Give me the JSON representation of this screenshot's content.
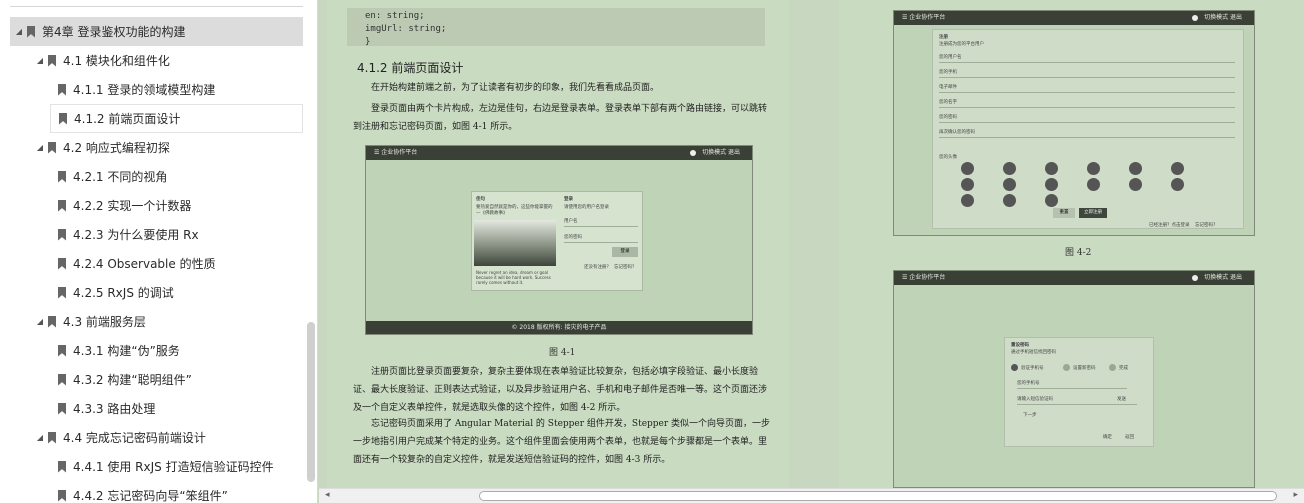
{
  "toc": [
    {
      "label": "第4章 登录鉴权功能的构建",
      "level": 0,
      "state": "selected"
    },
    {
      "label": "4.1 模块化和组件化",
      "level": 1
    },
    {
      "label": "4.1.1 登录的领域模型构建",
      "level": 2
    },
    {
      "label": "4.1.2 前端页面设计",
      "level": 2,
      "state": "current"
    },
    {
      "label": "4.2 响应式编程初探",
      "level": 1
    },
    {
      "label": "4.2.1 不同的视角",
      "level": 2
    },
    {
      "label": "4.2.2 实现一个计数器",
      "level": 2
    },
    {
      "label": "4.2.3 为什么要使用 Rx",
      "level": 2
    },
    {
      "label": "4.2.4 Observable 的性质",
      "level": 2
    },
    {
      "label": "4.2.5 RxJS 的调试",
      "level": 2
    },
    {
      "label": "4.3 前端服务层",
      "level": 1
    },
    {
      "label": "4.3.1 构建“伪”服务",
      "level": 2
    },
    {
      "label": "4.3.2 构建“聪明组件”",
      "level": 2
    },
    {
      "label": "4.3.3 路由处理",
      "level": 2
    },
    {
      "label": "4.4 完成忘记密码前端设计",
      "level": 1
    },
    {
      "label": "4.4.1 使用 RxJS 打造短信验证码控件",
      "level": 2
    },
    {
      "label": "4.4.2 忘记密码向导“笨组件”",
      "level": 2
    }
  ],
  "code": {
    "line1": "en: string;",
    "line2": "imgUrl: string;",
    "line3": "}"
  },
  "section_title": "4.1.2  前端页面设计",
  "p1": "在开始构建前端之前，为了让读者有初步的印象，我们先看看成品页面。",
  "p2": "登录页面由两个卡片构成，左边是佳句，右边是登录表单。登录表单下部有两个路由链接，可以跳转到注册和忘记密码页面，如图 4-1 所示。",
  "p3": "注册页面比登录页面要复杂，复杂主要体现在表单验证比较复杂，包括必填字段验证、最小长度验证、最大长度验证、正则表达式验证，以及异步验证用户名、手机和电子邮件是否唯一等。这个页面还涉及一个自定义表单控件，就是选取头像的这个控件，如图 4-2 所示。",
  "p4": "忘记密码页面采用了 Angular Material 的 Stepper 组件开发，Stepper 类似一个向导页面，一步一步地指引用户完成某个特定的业务。这个组件里面会使用两个表单，也就是每个步骤都是一个表单。里面还有一个较复杂的自定义控件，就是发送短信验证码的控件，如图 4-3 所示。",
  "fig1": {
    "caption": "图 4-1",
    "app": "☰ 企业协作平台",
    "right": "切换模式   退出",
    "quote_title": "佳句",
    "quote_text": "要热爱自然就是你的，这些你能掌握的",
    "quote_text2": "—《佛教故事》",
    "quote_en": "Never regret an idea, dream or goal because it will be hard work. Success rarely comes without it.",
    "login_title": "登录",
    "login_sub": "请使用您的用户名登录",
    "user": "用户名",
    "pwd": "您的密码",
    "submit": "登录",
    "reg": "还没有注册？",
    "forgot": "忘记密码？",
    "footer": "© 2018 版权所有: 接灾的电子产品"
  },
  "fig2": {
    "caption": "图 4-2",
    "app": "☰ 企业协作平台",
    "right": "切换模式   退出",
    "title": "注册",
    "sub": "注册成为您的平台用户",
    "fields": [
      "您的用户名",
      "您的手机",
      "电子邮件",
      "您的名字",
      "您的密码",
      "再次确认您的密码"
    ],
    "avatar_label": "您的头像",
    "btn_reset": "重置",
    "btn_submit": "立即注册",
    "link1": "已经注册？点击登录",
    "link2": "忘记密码?"
  },
  "fig3": {
    "app": "☰ 企业协作平台",
    "right": "切换模式   退出",
    "title": "重设密码",
    "sub": "通过手机短信找回密码",
    "step1": "验证手机号",
    "step2": "设置新密码",
    "step3": "完成",
    "field1": "您的手机号",
    "field2": "请输入短信验证码",
    "send": "发送",
    "next": "下一步",
    "btn_ok": "确定",
    "btn_cancel": "返回"
  }
}
